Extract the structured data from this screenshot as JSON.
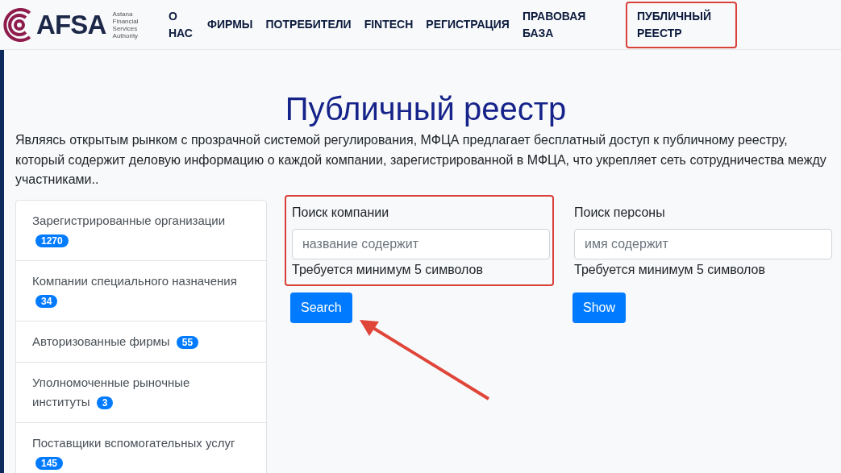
{
  "logo": {
    "name": "AFSA",
    "tagline": [
      "Astana",
      "Financial",
      "Services",
      "Authority"
    ]
  },
  "nav": [
    {
      "label": "О НАС",
      "highlighted": false
    },
    {
      "label": "ФИРМЫ",
      "highlighted": false
    },
    {
      "label": "ПОТРЕБИТЕЛИ",
      "highlighted": false
    },
    {
      "label": "FINTECH",
      "highlighted": false
    },
    {
      "label": "РЕГИСТРАЦИЯ",
      "highlighted": false
    },
    {
      "label": "ПРАВОВАЯ БАЗА",
      "highlighted": false
    },
    {
      "label": "ПУБЛИЧНЫЙ РЕЕСТР",
      "highlighted": true
    }
  ],
  "title": "Публичный реестр",
  "intro": "Являясь открытым рынком с прозрачной системой регулирования, МФЦА предлагает бесплатный доступ к публичному реестру, который содержит деловую информацию о каждой компании, зарегистрированной в МФЦА, что укрепляет сеть сотрудничества между участниками..",
  "categories": [
    {
      "label": "Зарегистрированные организации",
      "count": "1270"
    },
    {
      "label": "Компании специального назначения",
      "count": "34"
    },
    {
      "label": "Авторизованные фирмы",
      "count": "55"
    },
    {
      "label": "Уполномоченные рыночные институты",
      "count": "3"
    },
    {
      "label": "Поставщики вспомогательных услуг",
      "count": "145"
    }
  ],
  "searches": [
    {
      "label": "Поиск компании",
      "placeholder": "название содержит",
      "hint": "Требуется минимум 5 символов",
      "button": "Search",
      "highlighted": true
    },
    {
      "label": "Поиск персоны",
      "placeholder": "имя содержит",
      "hint": "Требуется минимум 5 символов",
      "button": "Show",
      "highlighted": false
    }
  ]
}
